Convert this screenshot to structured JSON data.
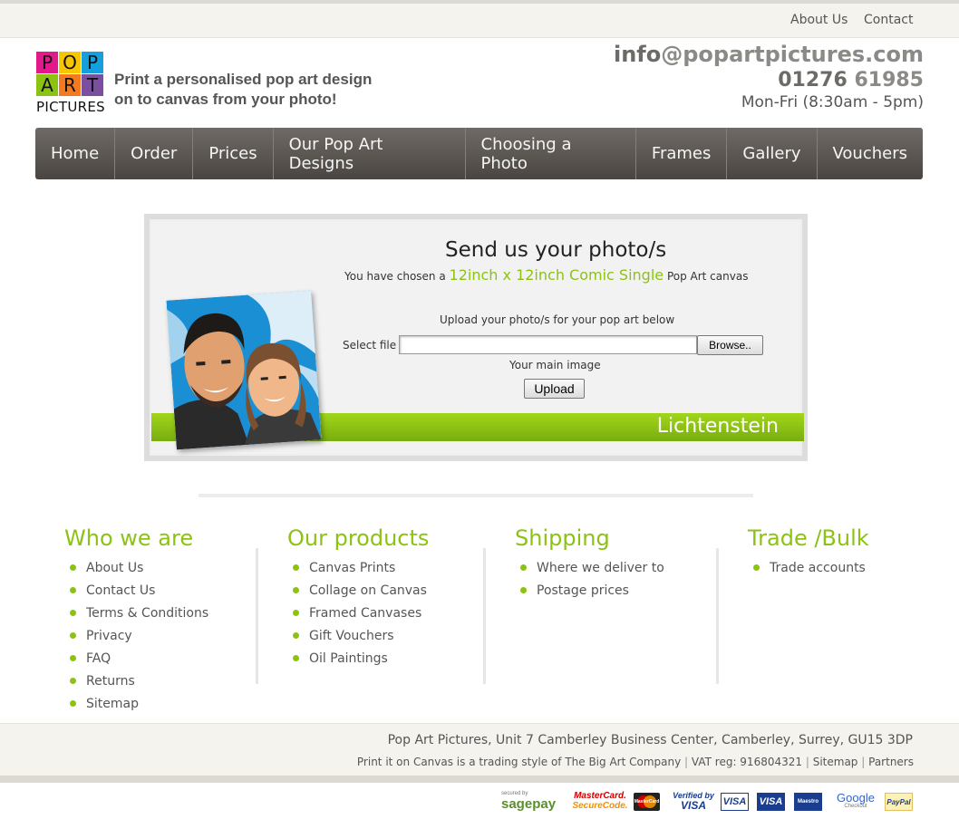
{
  "topbar": {
    "about": "About Us",
    "contact": "Contact"
  },
  "logo": {
    "letters": [
      "P",
      "O",
      "P",
      "A",
      "R",
      "T"
    ],
    "bottom": "PICTURES",
    "colors": [
      "#e2198a",
      "#f7c600",
      "#15a0dd",
      "#8cc313",
      "#f47a20",
      "#7a4fa0"
    ]
  },
  "header": {
    "tagline_1": "Print a personalised pop art design",
    "tagline_2": "on to canvas from your photo!",
    "email_user": "info",
    "email_domain": "@popartpictures.com",
    "phone_area": "01276",
    "phone_number": "61985",
    "hours": "Mon-Fri (8:30am - 5pm)"
  },
  "nav": [
    "Home",
    "Order",
    "Prices",
    "Our Pop Art Designs",
    "Choosing a Photo",
    "Frames",
    "Gallery",
    "Vouchers"
  ],
  "upload": {
    "title": "Send us your photo/s",
    "chosen_prefix": "You have chosen a",
    "chosen_product": "12inch x 12inch Comic Single",
    "chosen_suffix": "Pop Art canvas",
    "instructions": "Upload your photo/s for your pop art below",
    "select_label": "Select file",
    "file_value": "",
    "browse": "Browse..",
    "main_image": "Your main image",
    "upload_button": "Upload",
    "style": "Lichtenstein"
  },
  "footer_cols": [
    {
      "title": "Who we are",
      "items": [
        "About Us",
        "Contact Us",
        "Terms & Conditions",
        "Privacy",
        "FAQ",
        "Returns",
        "Sitemap"
      ]
    },
    {
      "title": "Our products",
      "items": [
        "Canvas Prints",
        "Collage on Canvas",
        "Framed Canvases",
        "Gift Vouchers",
        "Oil Paintings"
      ]
    },
    {
      "title": "Shipping",
      "items": [
        "Where we deliver to",
        "Postage prices"
      ]
    },
    {
      "title": "Trade /Bulk",
      "items": [
        "Trade accounts"
      ]
    }
  ],
  "footer": {
    "address": "Pop Art Pictures, Unit 7 Camberley Business Center, Camberley, Surrey, GU15 3DP",
    "trading": "Print it on Canvas is a trading style of The Big Art Company",
    "vat": "VAT reg: 916804321",
    "sitemap": "Sitemap",
    "partners": "Partners",
    "sep": "|"
  },
  "payments": {
    "sagepay_top": "secured by",
    "sagepay": "sagepay",
    "mastercard_1": "MasterCard.",
    "mastercard_2": "SecureCode.",
    "mastercard_card": "MasterCard",
    "verified_1": "Verified by",
    "verified_2": "VISA",
    "visa": "VISA",
    "visa_dark": "VISA",
    "maestro": "Maestro",
    "google_1": "Google",
    "google_2": "Checkout",
    "paypal": "PayPal"
  }
}
